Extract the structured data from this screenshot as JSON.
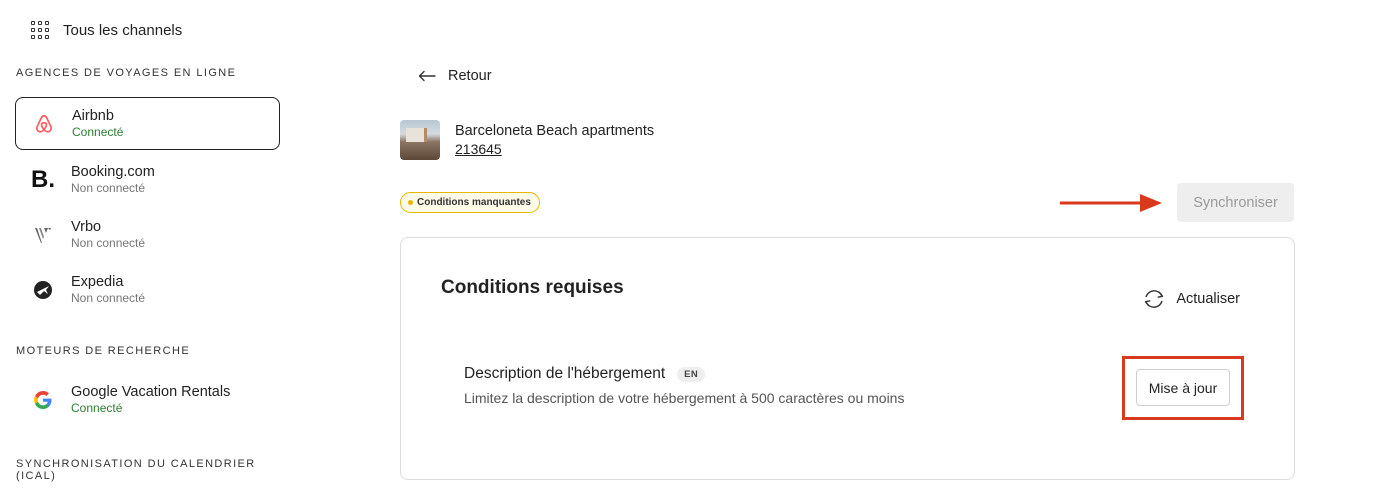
{
  "sidebar": {
    "all_channels_label": "Tous les channels",
    "sections": {
      "ota": "AGENCES DE VOYAGES EN LIGNE",
      "search": "MOTEURS DE RECHERCHE",
      "ical": "SYNCHRONISATION DU CALENDRIER (ICAL)"
    },
    "channels": [
      {
        "name": "Airbnb",
        "status": "Connecté",
        "icon": "airbnb-logo"
      },
      {
        "name": "Booking.com",
        "status": "Non connecté",
        "icon": "booking-logo"
      },
      {
        "name": "Vrbo",
        "status": "Non connecté",
        "icon": "vrbo-logo"
      },
      {
        "name": "Expedia",
        "status": "Non connecté",
        "icon": "expedia-logo"
      }
    ],
    "search_channels": [
      {
        "name": "Google Vacation Rentals",
        "status": "Connecté",
        "icon": "google-logo"
      }
    ]
  },
  "main": {
    "back_label": "Retour",
    "property": {
      "name": "Barceloneta Beach apartments",
      "id": "213645"
    },
    "badge": "Conditions manquantes",
    "sync_label": "Synchroniser",
    "card": {
      "title": "Conditions requises",
      "refresh_label": "Actualiser",
      "requirement": {
        "label": "Description de l'hébergement",
        "lang": "EN",
        "description": "Limitez la description de votre hébergement à 500 caractères ou moins",
        "button": "Mise à jour"
      }
    }
  },
  "colors": {
    "connected": "#2e7d32",
    "annotation_red": "#d93a1e",
    "badge_yellow": "#e6b800",
    "airbnb": "#ff5a5f"
  }
}
